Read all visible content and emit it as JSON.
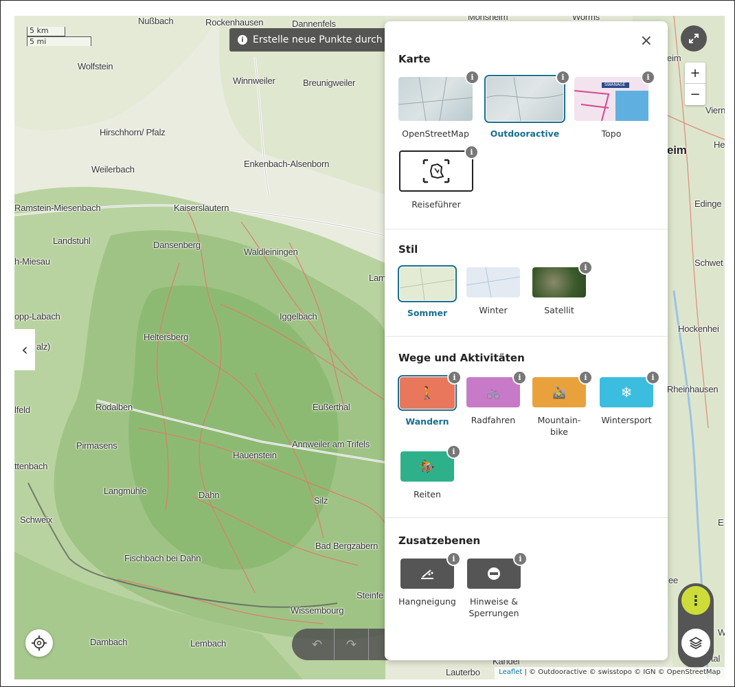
{
  "toast": {
    "text": "Erstelle neue Punkte durch"
  },
  "scale": {
    "km": "5 km",
    "mi": "5 mi"
  },
  "map_labels": [
    "Nußbach",
    "Rockenhausen",
    "Dannenfels",
    "Monsheim",
    "Worms",
    "Wolfstein",
    "Winnweiler",
    "Breunigweiler",
    "Hirschhorn/ Pfalz",
    "Enkenbach-Alsenborn",
    "Weilerbach",
    "Ramstein-Miesenbach",
    "Kaiserslautern",
    "Landstuhl",
    "Dansenberg",
    "Waldleiningen",
    "h-Miesau",
    "Lamb",
    "opp-Labach",
    "Iggelbach",
    "Heltersberg",
    "alz)",
    "Rodalben",
    "Eußerthal",
    "lfeld",
    "Pirmasens",
    "Annweiler am Trifels",
    "Hauenstein",
    "ttenbach",
    "Langmühle",
    "Dahn",
    "Silz",
    "Schweix",
    "Bad Bergzabern",
    "Fischbach bei Dahn",
    "Steinfe",
    "Wissembourg",
    "Dambach",
    "Lembach",
    "Lauterbo",
    "eim",
    "Viern",
    "He",
    "Edinge",
    "Schwet",
    "Hockenhei",
    "Rheinhausen",
    "ee",
    "E",
    "W",
    "tal",
    "Kandel"
  ],
  "map_label_big": "eim",
  "attribution": {
    "leaflet": "Leaflet",
    "rest": "| © Outdooractive © swisstopo © IGN © OpenStreetMap"
  },
  "controls": {
    "zoom_in": "+",
    "zoom_out": "−",
    "more": "⋮"
  },
  "panel": {
    "close": "×",
    "karte": {
      "title": "Karte",
      "items": [
        {
          "label": "OpenStreetMap",
          "selected": false
        },
        {
          "label": "Outdooractive",
          "selected": true
        },
        {
          "label": "Topo",
          "selected": false,
          "thumb_text": "SWANAGE"
        },
        {
          "label": "Reiseführer",
          "selected": false
        }
      ]
    },
    "stil": {
      "title": "Stil",
      "items": [
        {
          "label": "Sommer",
          "selected": true
        },
        {
          "label": "Winter",
          "selected": false
        },
        {
          "label": "Satellit",
          "selected": false
        }
      ]
    },
    "wege": {
      "title": "Wege und Aktivitäten",
      "items": [
        {
          "label": "Wandern",
          "selected": true,
          "color": "#e8775c"
        },
        {
          "label": "Radfahren",
          "selected": false,
          "color": "#c77ac7"
        },
        {
          "label": "Mountain-\nbike",
          "selected": false,
          "color": "#e9a23b"
        },
        {
          "label": "Wintersport",
          "selected": false,
          "color": "#3bbde0"
        },
        {
          "label": "Reiten",
          "selected": false,
          "color": "#2eb08a"
        }
      ]
    },
    "zusatz": {
      "title": "Zusatzebenen",
      "items": [
        {
          "label": "Hangneigung"
        },
        {
          "label": "Hinweise &\nSperrungen"
        }
      ]
    },
    "info_badge": "i"
  }
}
